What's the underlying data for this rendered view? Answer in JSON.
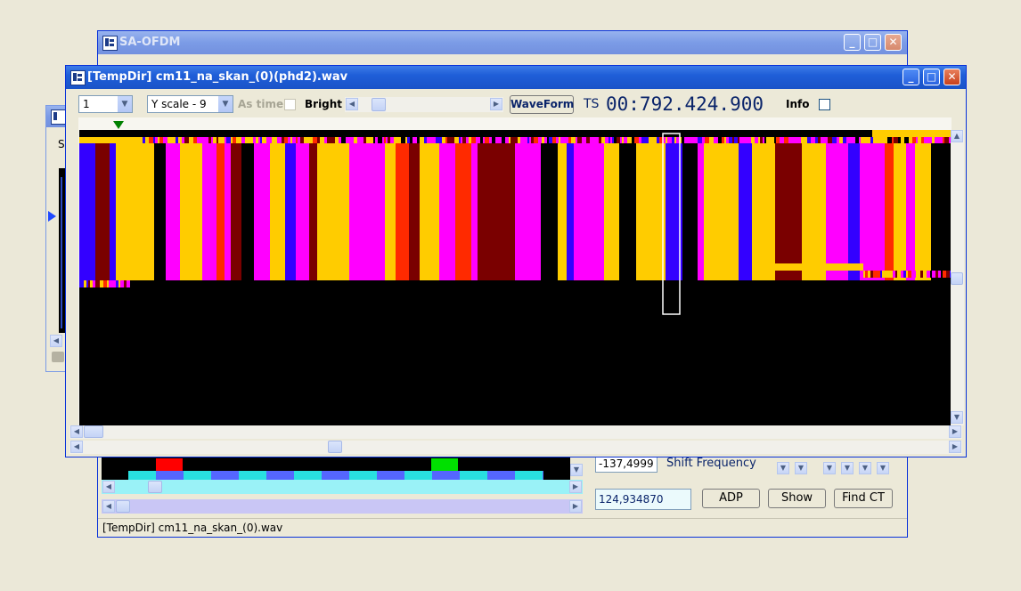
{
  "back_window": {
    "title": "SA-OFDM",
    "status_text": "[TempDir] cm11_na_skan_(0).wav",
    "freq_value": "-137,4999",
    "shift_label": "Shift Frequency",
    "second_value": "124,934870",
    "buttons": {
      "adp": "ADP",
      "show": "Show",
      "find_ct": "Find CT"
    }
  },
  "left_window": {
    "partial_label": "S"
  },
  "main_window": {
    "title": "[TempDir] cm11_na_skan_(0)(phd2).wav",
    "toolbar": {
      "channel_value": "1",
      "yscale_value": "Y scale - 9",
      "as_time_label": "As time",
      "bright_label": "Bright",
      "waveform_label": "WaveForm",
      "ts_label": "TS",
      "ts_value": "00:792.424.900",
      "info_label": "Info"
    }
  },
  "colors": {
    "title_active": "#1f5ed8",
    "magenta": "#ff00ff",
    "yellow": "#ffcc00",
    "blue": "#3300ff",
    "red": "#ff2a00",
    "marker": "#008000",
    "cyan": "#66ffff"
  },
  "icons": [
    "app-icon",
    "minimize-icon",
    "maximize-icon",
    "close-icon",
    "chevron-down-icon",
    "arrow-left-icon",
    "arrow-right-icon",
    "arrow-up-icon",
    "arrow-down-icon"
  ]
}
